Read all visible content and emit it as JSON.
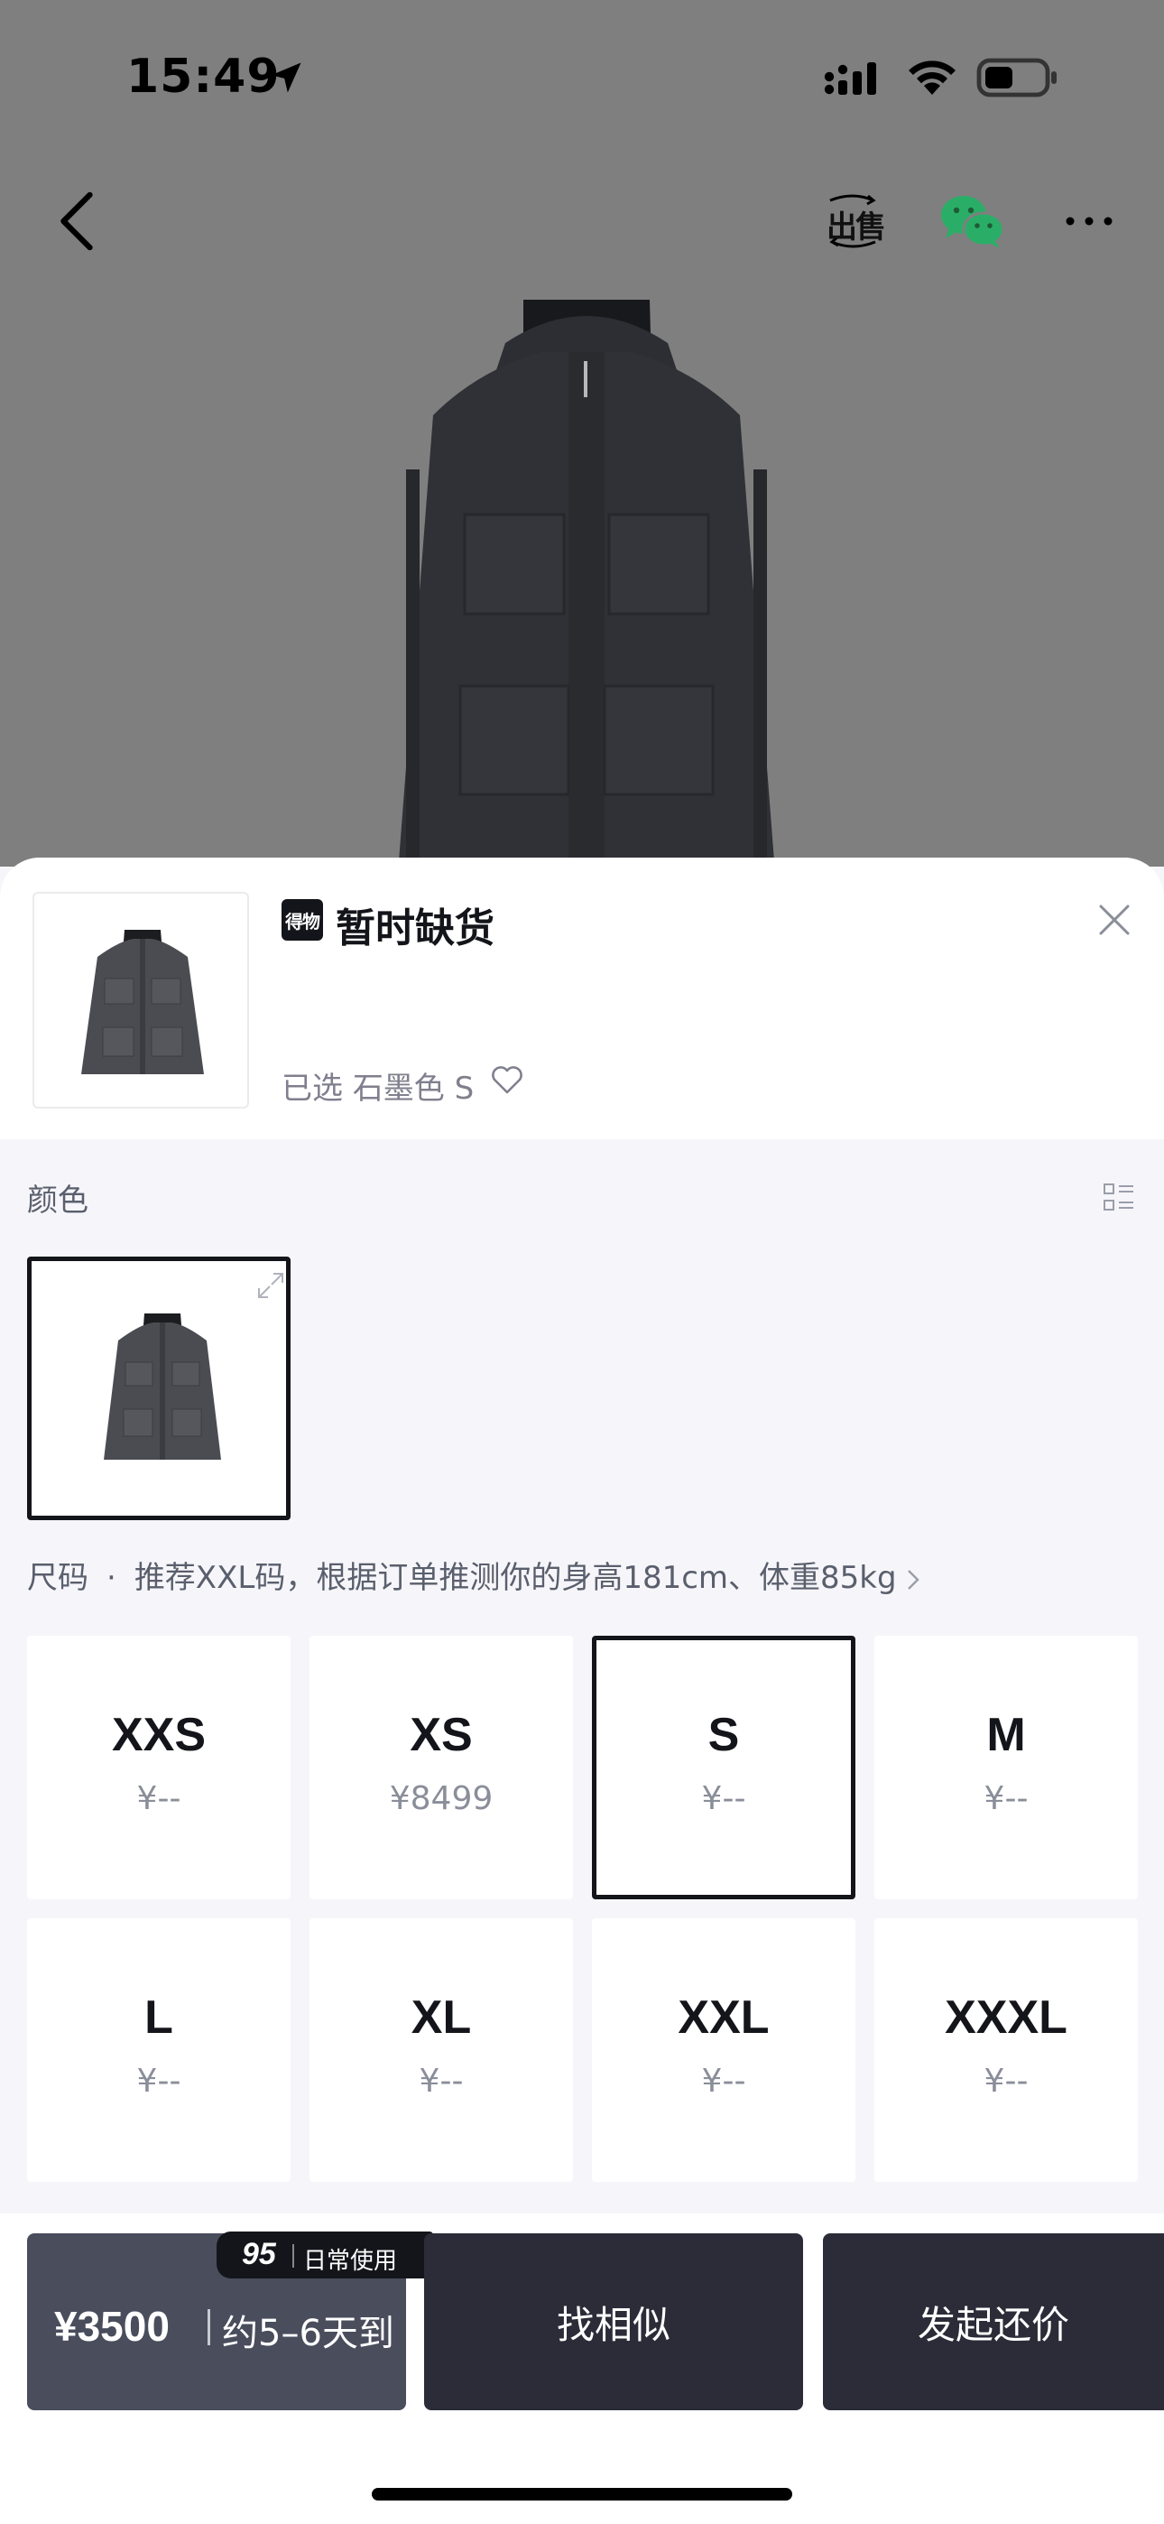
{
  "status_bar": {
    "time": "15:49"
  },
  "nav": {
    "sell_label": "出售"
  },
  "sheet": {
    "brand_logo_text": "得物",
    "stock_status": "暂时缺货",
    "selected_prefix": "已选",
    "selected_color": "石墨色",
    "selected_size": "S"
  },
  "color_section": {
    "label": "颜色"
  },
  "size_section": {
    "label": "尺码",
    "separator": "·",
    "recommendation": "推荐XXL码，根据订单推测你的身高181cm、体重85kg"
  },
  "sizes": [
    {
      "name": "XXS",
      "price": "¥--"
    },
    {
      "name": "XS",
      "price": "¥8499"
    },
    {
      "name": "S",
      "price": "¥--",
      "selected": true
    },
    {
      "name": "M",
      "price": "¥--"
    },
    {
      "name": "L",
      "price": "¥--"
    },
    {
      "name": "XL",
      "price": "¥--"
    },
    {
      "name": "XXL",
      "price": "¥--"
    },
    {
      "name": "XXXL",
      "price": "¥--"
    }
  ],
  "action_bar": {
    "buy_price": "¥3500",
    "buy_eta": "约5–6天到",
    "badge_number": "95",
    "badge_text": "日常使用",
    "similar_label": "找相似",
    "offer_label": "发起还价"
  },
  "colors": {
    "overlay_gray": "#7f7f7f",
    "primary_dark": "#14151a",
    "button_dark": "#2b2c38",
    "buy_button": "#494d5c",
    "wechat_green": "#2aae67",
    "sheet_bg": "#f6f6fa"
  }
}
